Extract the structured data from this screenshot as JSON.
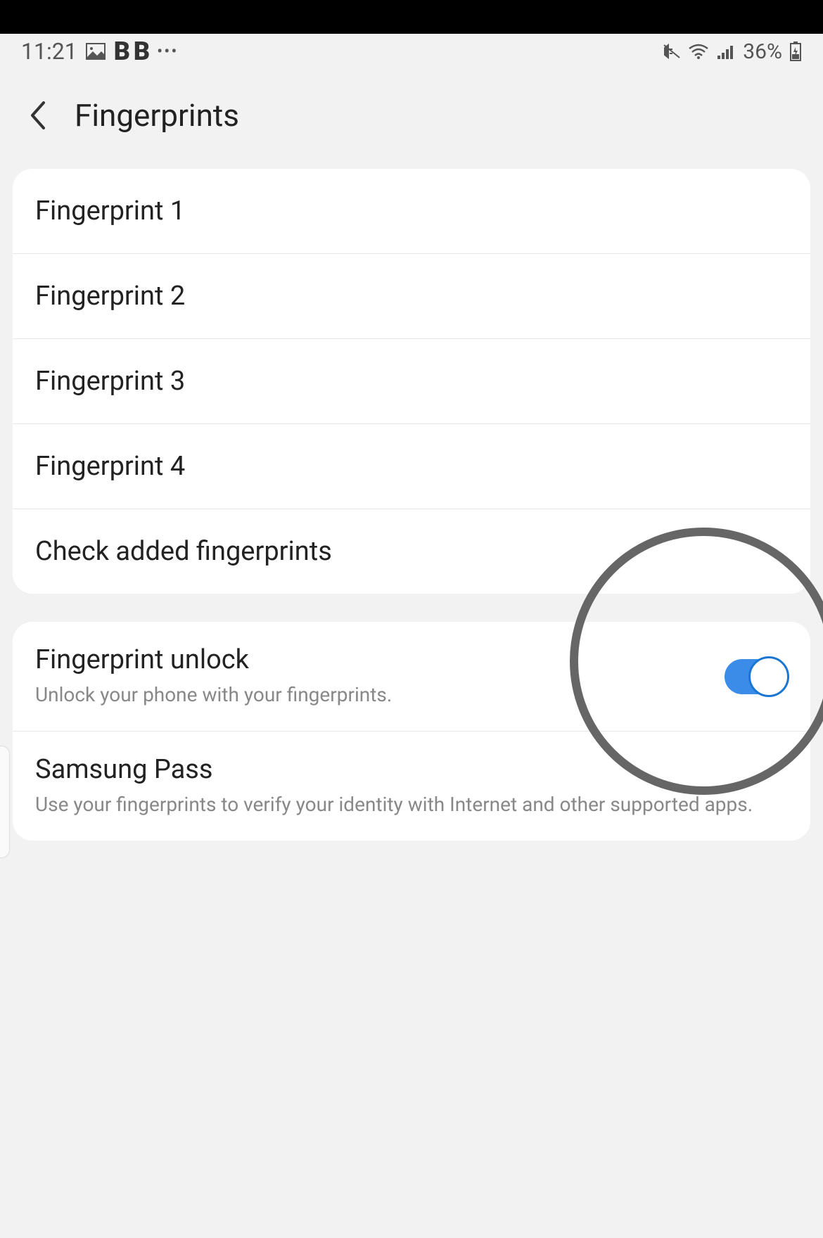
{
  "status_bar": {
    "time": "11:21",
    "bold_letters": "B B",
    "battery_percent": "36%"
  },
  "header": {
    "title": "Fingerprints"
  },
  "fingerprints": {
    "items": [
      {
        "label": "Fingerprint 1"
      },
      {
        "label": "Fingerprint 2"
      },
      {
        "label": "Fingerprint 3"
      },
      {
        "label": "Fingerprint 4"
      }
    ],
    "check_label": "Check added fingerprints"
  },
  "settings": {
    "unlock": {
      "title": "Fingerprint unlock",
      "subtitle": "Unlock your phone with your fingerprints.",
      "enabled": true
    },
    "samsung_pass": {
      "title": "Samsung Pass",
      "subtitle": "Use your fingerprints to verify your identity with Internet and other supported apps."
    }
  }
}
